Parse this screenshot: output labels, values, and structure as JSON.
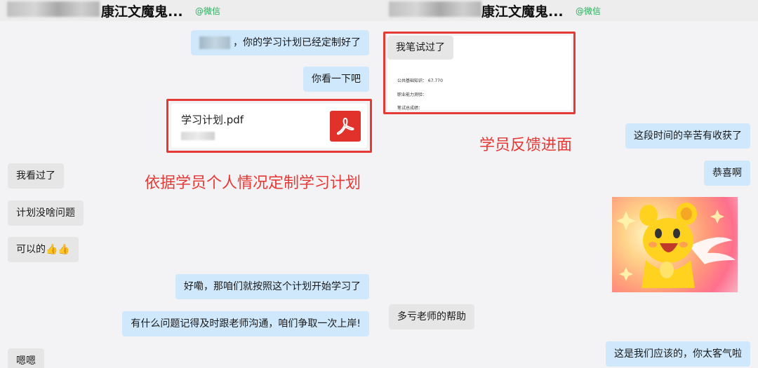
{
  "left": {
    "header": {
      "name": "康江文魔鬼...",
      "tag": "@微信"
    },
    "messages": [
      {
        "side": "me",
        "text": "，你的学习计划已经定制好了"
      },
      {
        "side": "me",
        "text": "你看一下吧"
      },
      {
        "side": "other",
        "text": "我看过了"
      },
      {
        "side": "other",
        "text": "计划没啥问题"
      },
      {
        "side": "other",
        "text": "可以的👍👍"
      },
      {
        "side": "me",
        "text": "好嘞，那咱们就按照这个计划开始学习了"
      },
      {
        "side": "me",
        "text": "有什么问题记得及时跟老师沟通，咱们争取一次上岸!"
      },
      {
        "side": "other",
        "text": "嗯嗯"
      }
    ],
    "file": {
      "name": "学习计划.pdf",
      "icon": "pdf-icon"
    },
    "caption": "依据学员个人情况定制学习计划"
  },
  "right": {
    "header": {
      "name": "康江文魔鬼...",
      "tag": "@微信"
    },
    "messages": [
      {
        "side": "other",
        "text": "我笔试过了"
      },
      {
        "side": "me",
        "text": "这段时间的辛苦有收获了"
      },
      {
        "side": "me",
        "text": "恭喜啊"
      },
      {
        "side": "other",
        "text": "多亏老师的帮助"
      },
      {
        "side": "me",
        "text": "这是我们应该的，你太客气啦"
      }
    ],
    "score_image": {
      "lines": [
        "公共基础知识：  67.770",
        "职业能力测验：",
        "笔试总成绩："
      ]
    },
    "sticker": "cartoon-sticker",
    "caption": "学员反馈进面"
  },
  "colors": {
    "accent_red": "#e53935",
    "bubble_me": "#cfe8fb",
    "bubble_other": "#e6e6e6",
    "wechat_green": "#2bad5e"
  }
}
